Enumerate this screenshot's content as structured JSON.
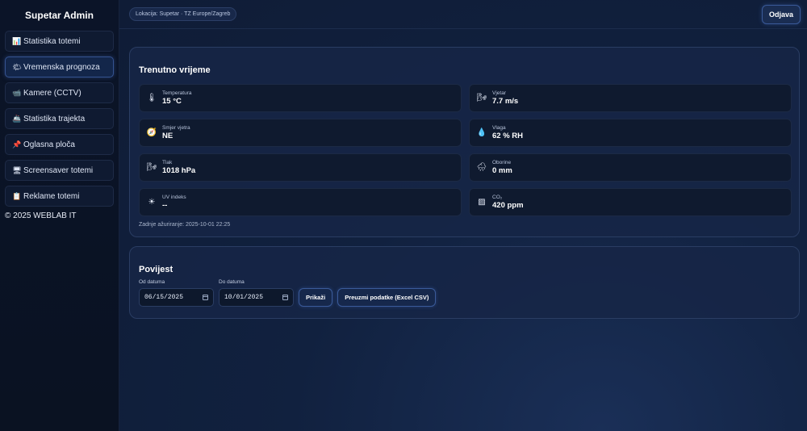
{
  "sidebar": {
    "brand": "Supetar Admin",
    "items": [
      {
        "icon": "📊",
        "label": "Statistika totemi"
      },
      {
        "icon": "🌤",
        "label": "Vremenska prognoza"
      },
      {
        "icon": "📹",
        "label": "Kamere (CCTV)"
      },
      {
        "icon": "🚢",
        "label": "Statistika trajekta"
      },
      {
        "icon": "📌",
        "label": "Oglasna ploča"
      },
      {
        "icon": "🖥",
        "label": "Screensaver totemi"
      },
      {
        "icon": "📋",
        "label": "Reklame totemi"
      }
    ],
    "active_index": 1,
    "footer": "© 2025 WEBLAB IT"
  },
  "topbar": {
    "location": "Lokacija: Supetar · TZ Europe/Zagreb",
    "logout_label": "Odjava"
  },
  "current": {
    "title": "Trenutno vrijeme",
    "tiles": [
      {
        "icon": "🌡",
        "label": "Temperatura",
        "value": "15 °C"
      },
      {
        "icon": "🌬",
        "label": "Vjetar",
        "value": "7.7 m/s"
      },
      {
        "icon": "🧭",
        "label": "Smjer vjetra",
        "value": "NE"
      },
      {
        "icon": "💧",
        "label": "Vlaga",
        "value": "62 % RH"
      },
      {
        "icon": "🌬",
        "label": "Tlak",
        "value": "1018 hPa"
      },
      {
        "icon": "🌧",
        "label": "Oborine",
        "value": "0 mm"
      },
      {
        "icon": "☀",
        "label": "UV indeks",
        "value": "--"
      },
      {
        "icon": "▨",
        "label": "CO₂",
        "value": "420 ppm"
      }
    ],
    "updated": "Zadnje ažuriranje: 2025-10-01 22:25"
  },
  "history": {
    "title": "Povijest",
    "from_label": "Od datuma",
    "from_value": "06/15/2025",
    "to_label": "Do datuma",
    "to_value": "10/01/2025",
    "show_label": "Prikaži",
    "download_label": "Preuzmi podatke (Excel CSV)"
  }
}
